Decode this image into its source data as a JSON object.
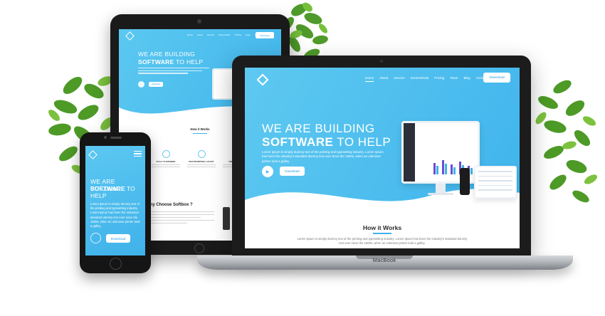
{
  "accent_color": "#45b8ee",
  "laptop": {
    "brand": "MacBook",
    "nav": [
      "Home",
      "About",
      "Service",
      "Screenshots",
      "Pricing",
      "Team",
      "Blog",
      "Contact"
    ],
    "download_label": "Download",
    "hero": {
      "line1": "WE ARE BUILDING",
      "line2_bold": "SOFTWARE",
      "line2_rest": " TO HELP",
      "body": "Lorem Ipsum is simply dummy text of the printing and typesetting industry. Lorem Ipsum has been the industry's standard dummy text ever since the 1500s, when an unknown printer took a galley.",
      "cta": "Download"
    },
    "how": {
      "title": "How it Works",
      "body": "Lorem ipsum is simply dummy text of the printing and typesetting industry. Lorem ipsum has been the industry's standard dummy text ever since the 1500s, when an unknown printer took a galley."
    }
  },
  "tablet": {
    "nav": [
      "Home",
      "About",
      "Service",
      "Screenshots",
      "Pricing",
      "Team",
      "Blog",
      "Contact"
    ],
    "download_label": "Download",
    "hero": {
      "line1": "WE ARE BUILDING",
      "line2_bold": "SOFTWARE",
      "line2_rest": " TO HELP",
      "cta": "Download"
    },
    "how_title": "How it Works",
    "features": [
      "FULLY CUSTOMIZE",
      "MULTIPURPOSE LAYOUT",
      "CREATE DESIGN"
    ],
    "why_title": "Why Choose Softbox ?"
  },
  "phone": {
    "hero": {
      "line1": "WE ARE BUILDING",
      "line2_bold": "SOFTWARE",
      "line2_rest": " TO HELP",
      "body": "Lorem ipsum is simply dummy text of the printing and typesetting industry. Lorem ipsum has been the industry's standard dummy text ever since the 1500s, when an unknown printer took a galley.",
      "cta": "Download"
    }
  }
}
